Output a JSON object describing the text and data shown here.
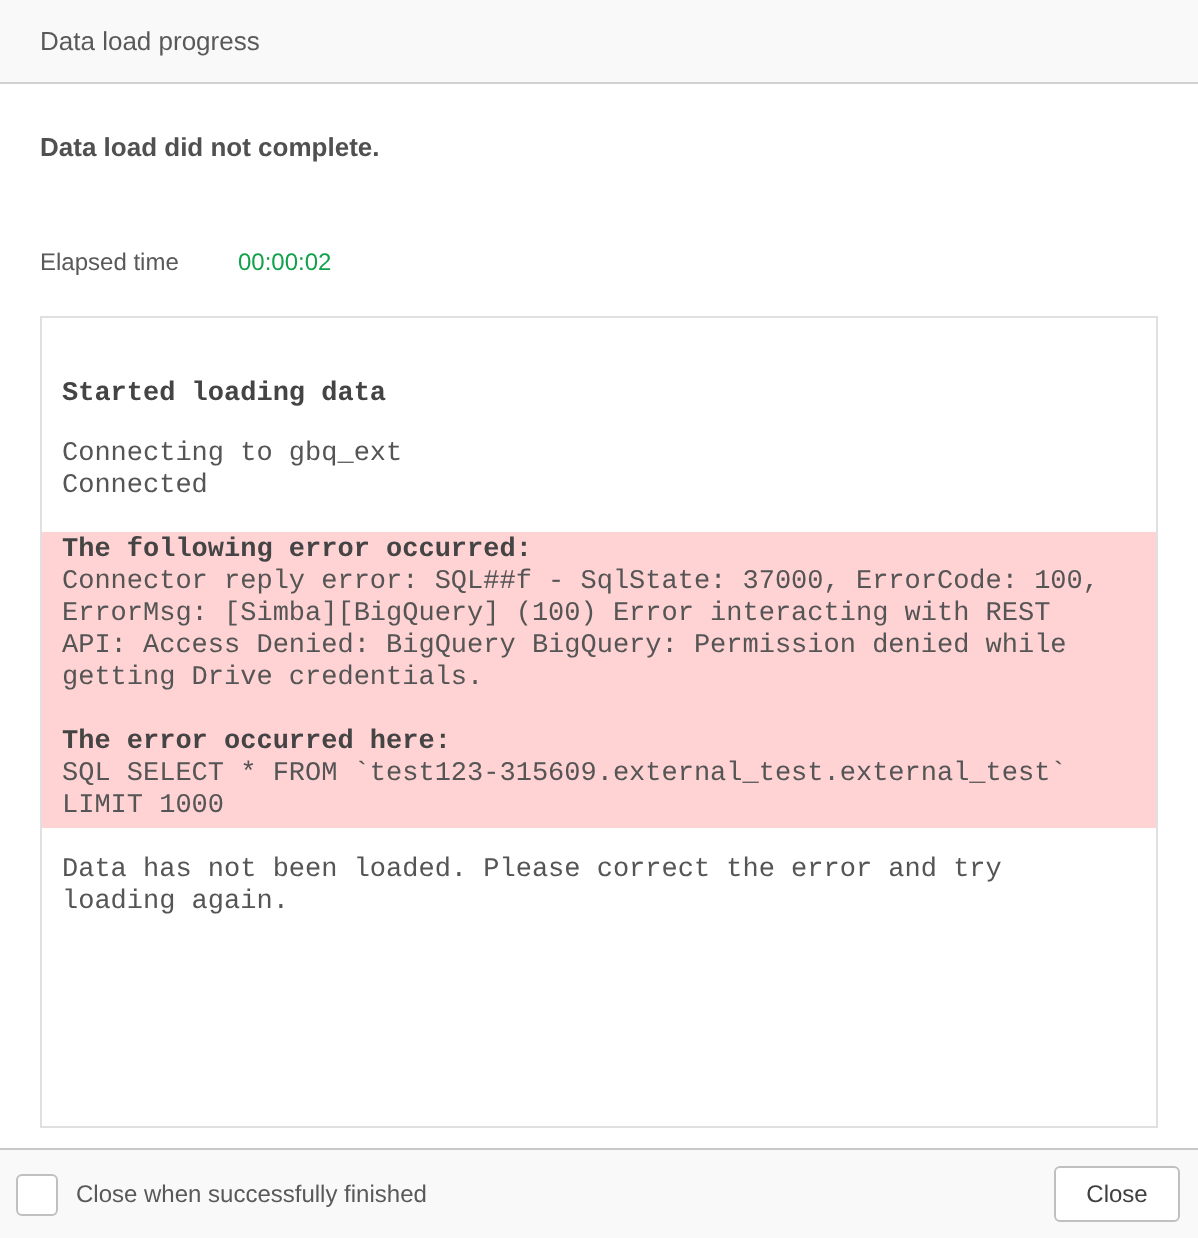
{
  "window": {
    "title": "Data load progress"
  },
  "status": "Data load did not complete.",
  "elapsed": {
    "label": "Elapsed time",
    "value": "00:00:02"
  },
  "log": [
    {
      "kind": "normal",
      "lines": [
        {
          "kind": "heading",
          "text": "Started loading data"
        }
      ]
    },
    {
      "kind": "normal",
      "lines": [
        {
          "kind": "text",
          "text": "Connecting to gbq_ext"
        },
        {
          "kind": "text",
          "text": "Connected"
        }
      ]
    },
    {
      "kind": "error",
      "lines": [
        {
          "kind": "heading",
          "text": "The following error occurred:"
        },
        {
          "kind": "text",
          "text": "Connector reply error: SQL##f - SqlState: 37000, ErrorCode: 100,"
        },
        {
          "kind": "text",
          "text": "ErrorMsg: [Simba][BigQuery] (100) Error interacting with REST"
        },
        {
          "kind": "text",
          "text": "API: Access Denied: BigQuery BigQuery: Permission denied while"
        },
        {
          "kind": "text",
          "text": "getting Drive credentials."
        },
        {
          "kind": "heading",
          "text": "The error occurred here:"
        },
        {
          "kind": "text",
          "text": "SQL SELECT * FROM `test123-315609.external_test.external_test`"
        },
        {
          "kind": "text",
          "text": "LIMIT 1000"
        }
      ]
    },
    {
      "kind": "normal",
      "lines": [
        {
          "kind": "text",
          "text": "Data has not been loaded. Please correct the error and try"
        },
        {
          "kind": "text",
          "text": "loading again."
        }
      ]
    }
  ],
  "footer": {
    "checkbox": {
      "label": "Close when successfully finished",
      "checked": false
    },
    "button": "Close"
  }
}
